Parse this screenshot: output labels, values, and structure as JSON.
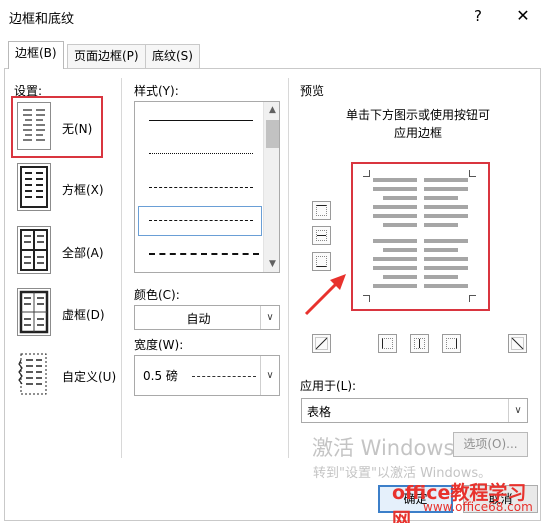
{
  "window": {
    "title": "边框和底纹",
    "help": "?",
    "close": "✕"
  },
  "tabs": [
    {
      "label": "边框(B)"
    },
    {
      "label": "页面边框(P)"
    },
    {
      "label": "底纹(S)"
    }
  ],
  "settings": {
    "label": "设置:",
    "items": [
      {
        "label": "无(N)",
        "selected": true
      },
      {
        "label": "方框(X)"
      },
      {
        "label": "全部(A)"
      },
      {
        "label": "虚框(D)"
      },
      {
        "label": "自定义(U)"
      }
    ]
  },
  "style": {
    "label": "样式(Y):",
    "options": [
      "solid",
      "dotted",
      "dashed-fine",
      "dashed",
      "dash-long"
    ],
    "selected_index": 3
  },
  "color": {
    "label": "颜色(C):",
    "value": "自动"
  },
  "width": {
    "label": "宽度(W):",
    "value": "0.5 磅"
  },
  "preview": {
    "label": "预览",
    "hint_line1": "单击下方图示或使用按钮可",
    "hint_line2": "应用边框"
  },
  "apply_to": {
    "label": "应用于(L):",
    "value": "表格"
  },
  "options_button": "选项(O)...",
  "watermark": {
    "line1": "激活 Windows",
    "line2": "转到\"设置\"以激活 Windows。"
  },
  "ok_button": "确定",
  "cancel_button": "取消",
  "site_overlay": {
    "brand": "office教程学习网",
    "url": "www.office68.com"
  },
  "colors": {
    "highlight_red": "#d9353f",
    "arrow_red": "#e8322d",
    "accent_blue": "#3c7fc9"
  },
  "icons": [
    "help-icon",
    "close-icon",
    "scroll-up-icon",
    "scroll-down-icon",
    "dropdown-arrow-icon",
    "annotation-arrow-icon"
  ]
}
